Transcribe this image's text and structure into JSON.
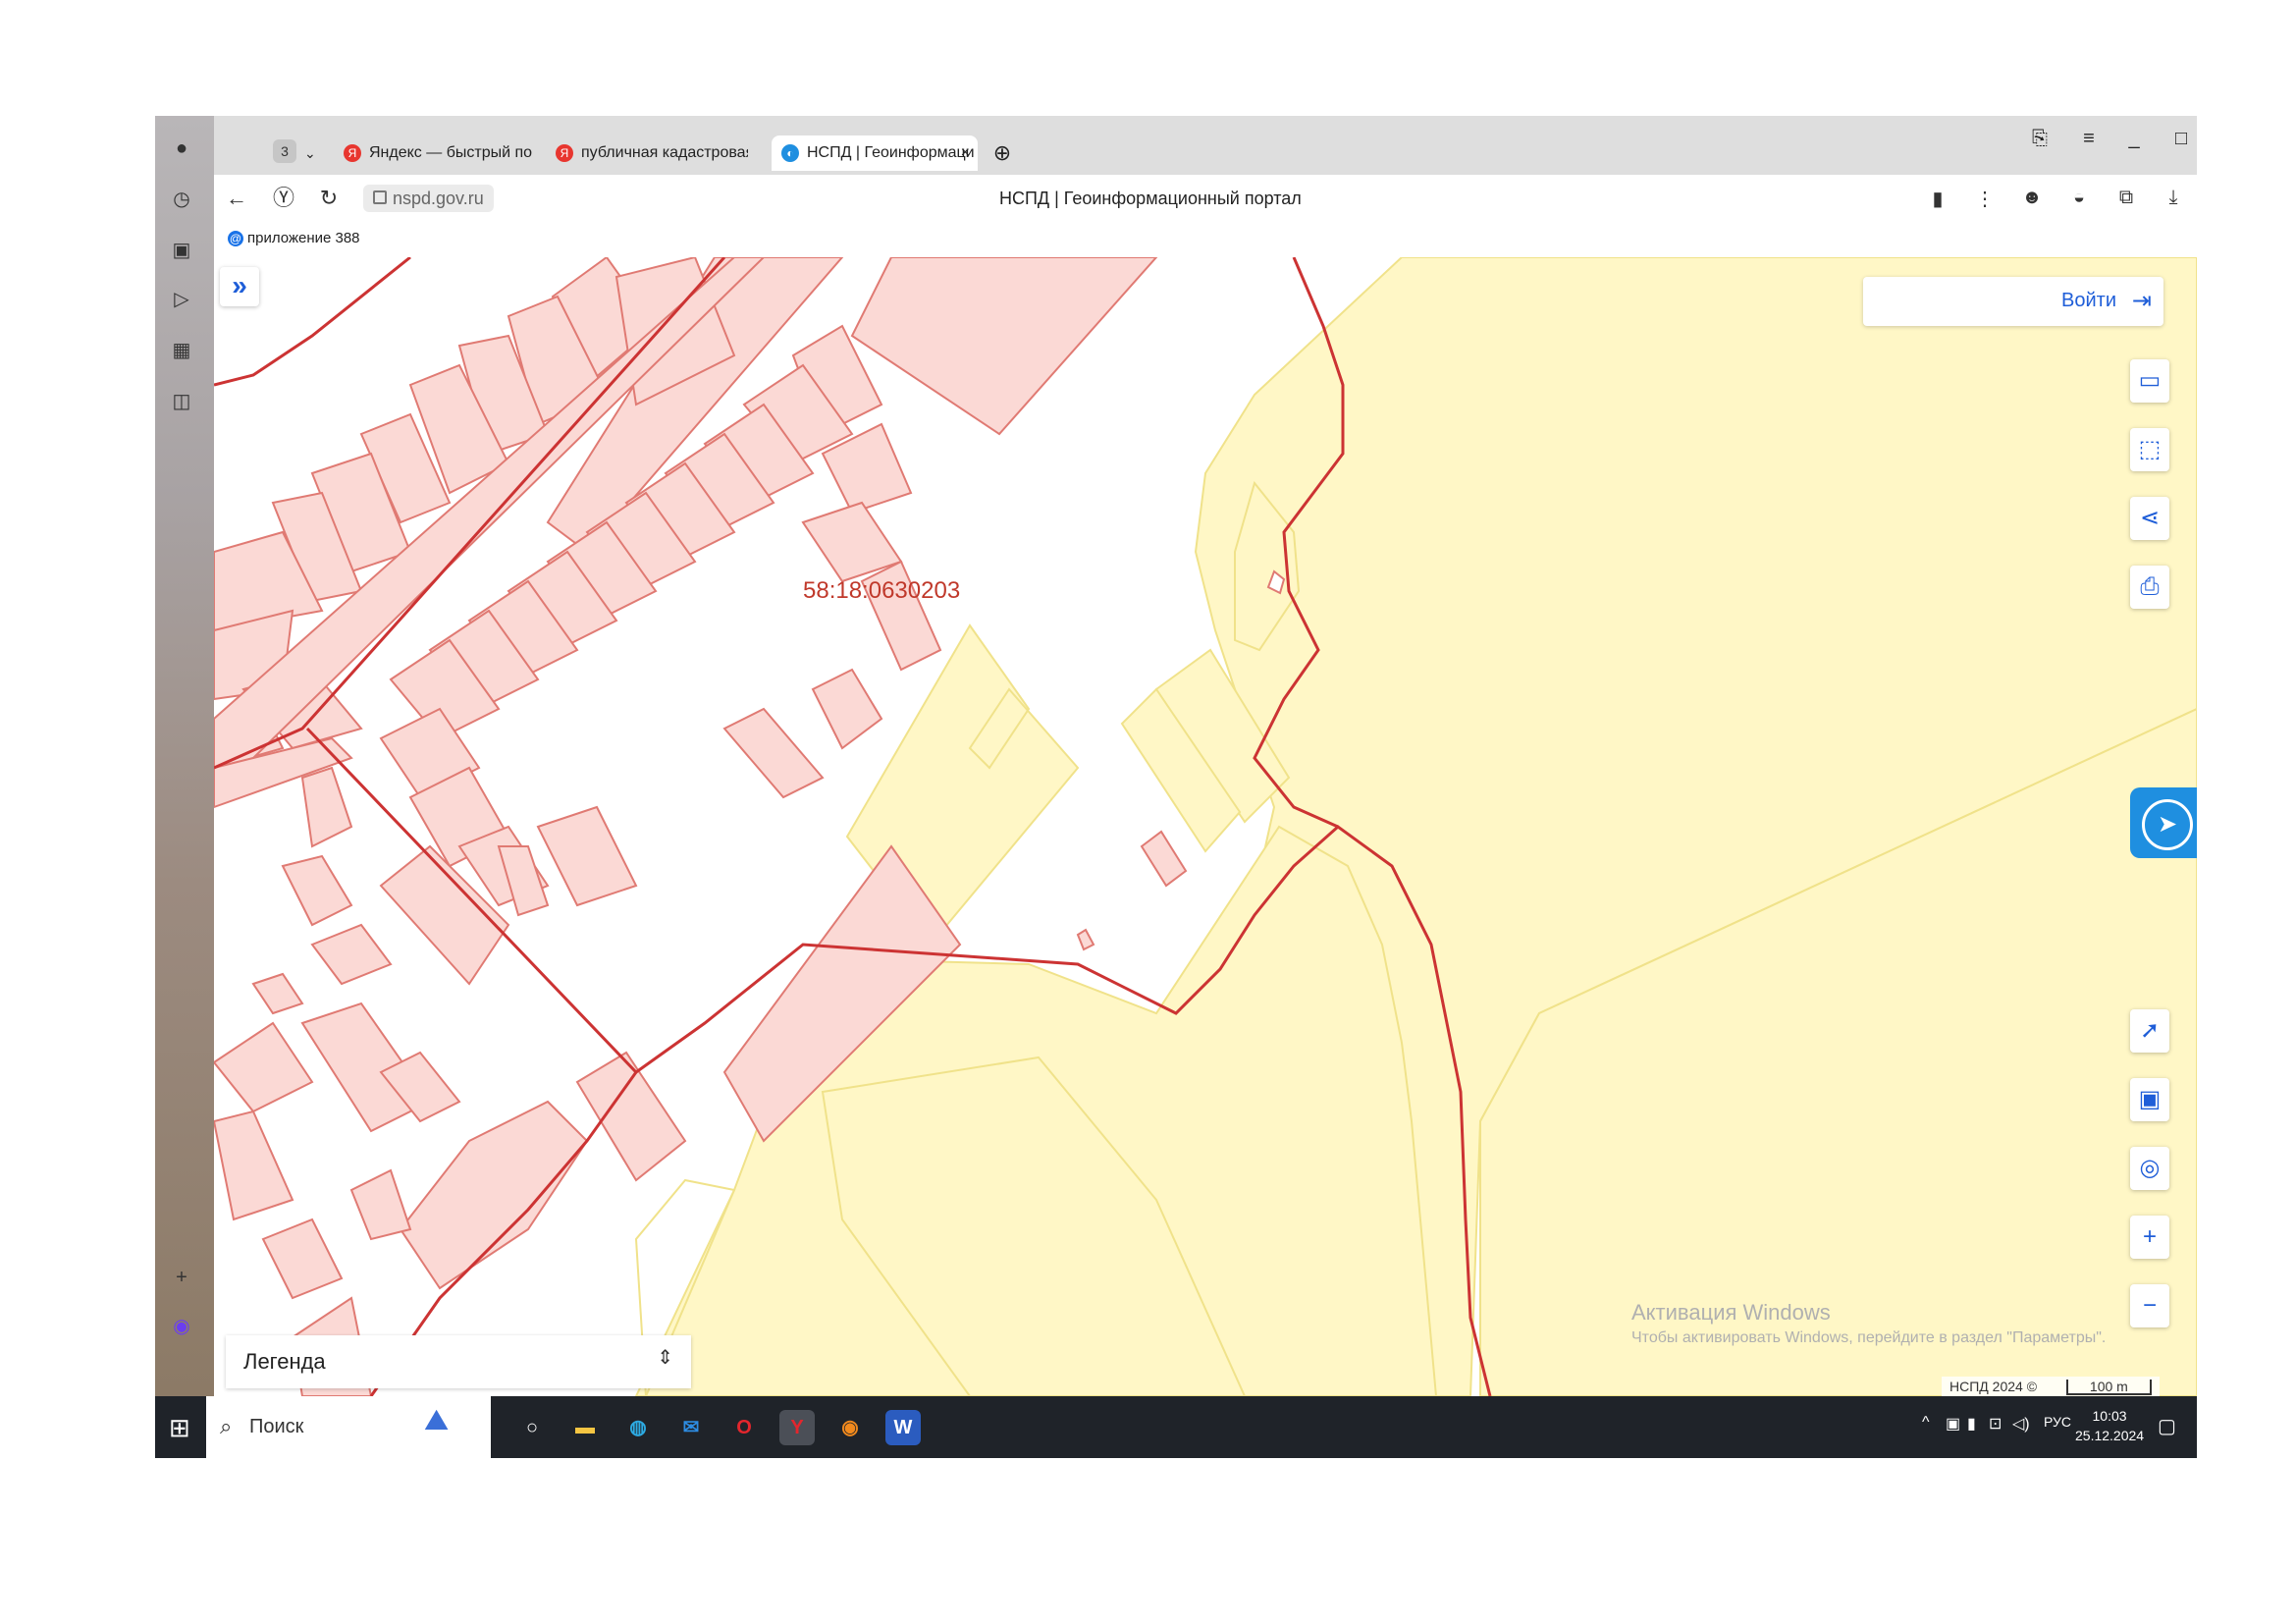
{
  "browser": {
    "tab_count": "3",
    "tabs": [
      {
        "label": "Яндекс — быстрый поиск",
        "favicon": "Я"
      },
      {
        "label": "публичная кадастровая к",
        "favicon": "Я"
      },
      {
        "label": "НСПД | Геоинформаци",
        "favicon": "geo-portal-icon"
      }
    ],
    "url": "nspd.gov.ru",
    "page_title": "НСПД | Геоинформационный портал",
    "bookmark": "приложение 388"
  },
  "map": {
    "login_label": "Войти",
    "parcel_label": "58:18:0630203",
    "legend_label": "Легенда",
    "watermark": {
      "title": "Активация Windows",
      "subtitle": "Чтобы активировать Windows, перейдите в раздел \"Параметры\"."
    },
    "copyright": "НСПД 2024 ©",
    "scale": "100 m",
    "tools": [
      "ruler-icon",
      "select-area-icon",
      "share-icon",
      "print-icon",
      "locate-icon",
      "layers-icon",
      "geolocation-icon",
      "zoom-in-icon",
      "zoom-out-icon"
    ],
    "colors": {
      "parcel_fill": "#fbd9d5",
      "parcel_stroke": "#e07a73",
      "boundary": "#cc3333",
      "land_fill": "#fff7c6",
      "land_stroke": "#f0e28a",
      "accent": "#1f5ed8"
    }
  },
  "taskbar": {
    "search_label": "Поиск",
    "language": "РУС",
    "time": "10:03",
    "date": "25.12.2024"
  }
}
